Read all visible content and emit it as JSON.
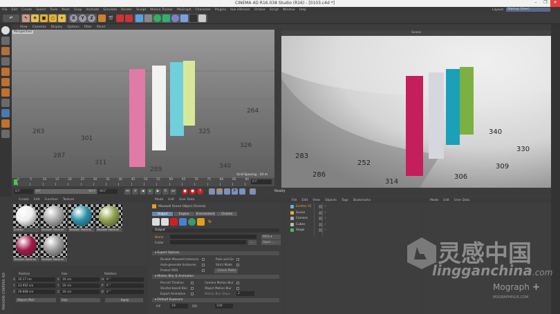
{
  "window": {
    "title": "CINEMA 4D R16.038 Studio (R16) - [0103.c4d *]",
    "minimize": "–",
    "maximize": "❐",
    "close": "✕"
  },
  "menu": [
    "File",
    "Edit",
    "Create",
    "Select",
    "Tools",
    "Mesh",
    "Snap",
    "Animate",
    "Simulate",
    "Render",
    "Sculpt",
    "Motion Tracker",
    "MoGraph",
    "Character",
    "Plugins",
    "Vue xStream",
    "Octane",
    "Script",
    "Window",
    "Help"
  ],
  "layout": {
    "label": "Layout:",
    "value": "Startup (User)"
  },
  "toolbar": {
    "axis_x": "X",
    "axis_y": "Y",
    "axis_z": "Z"
  },
  "viewport_left": {
    "menu": [
      "View",
      "Cameras",
      "Display",
      "Options",
      "Filter",
      "Panel"
    ],
    "name": "Perspective",
    "grid_spacing": "Grid Spacing : 10 m",
    "floor_numbers": [
      "311",
      "287",
      "340",
      "326",
      "289",
      "263",
      "325",
      "301",
      "264"
    ]
  },
  "viewport_right": {
    "name": "Scene",
    "floor_numbers": [
      "286",
      "314",
      "309",
      "330",
      "283",
      "306",
      "340",
      "252"
    ]
  },
  "timeline": {
    "ticks": [
      "0",
      "5",
      "10",
      "15",
      "20",
      "25",
      "30",
      "35",
      "40",
      "45",
      "50",
      "55",
      "60",
      "65",
      "70",
      "75",
      "80",
      "85",
      "90"
    ],
    "current_frame": "0 F",
    "start": "0 F",
    "range_start": "0 F",
    "range_end": "90 F",
    "end": "90 F"
  },
  "status": "Ready",
  "materials": {
    "menu": [
      "Create",
      "Edit",
      "Function",
      "Texture"
    ],
    "items": [
      {
        "label": "Emitter",
        "color": "#eeeeee"
      },
      {
        "label": "Maxwell Material",
        "color": "#a8a8a8"
      },
      {
        "label": "Maxwell Material",
        "color": "#2a8faa"
      },
      {
        "label": "Maxwell Material",
        "color": "#8ea048"
      },
      {
        "label": "Maxwell Material",
        "color": "#a3184a"
      },
      {
        "label": "Maxwell Material",
        "color": "#9a9a9a"
      }
    ]
  },
  "coordinates": {
    "position_label": "Position",
    "size_label": "Size",
    "rotation_label": "Rotation",
    "rows": [
      {
        "axis": "X",
        "pos": "35.17 cm",
        "size_axis": "X",
        "size": "10 cm",
        "rot_axis": "H",
        "rot": "0 °"
      },
      {
        "axis": "Y",
        "pos": "23.952 cm",
        "size_axis": "Y",
        "size": "10 cm",
        "rot_axis": "P",
        "rot": "0 °"
      },
      {
        "axis": "Z",
        "pos": "29.668 cm",
        "size_axis": "Z",
        "size": "10 cm",
        "rot_axis": "B",
        "rot": "0 °"
      }
    ],
    "mode": "Object (Rel)",
    "size_mode": "Size",
    "apply": "Apply"
  },
  "brand_vertical": "MAXON CINEMA 4D",
  "attributes": {
    "menu": [
      "Mode",
      "Edit",
      "User Data"
    ],
    "object": "Maxwell Scene Object [Scene]",
    "tabs": [
      "Output",
      "Engine",
      "Environment",
      "Cinema"
    ],
    "active_tab": "Output",
    "section_output": "Output",
    "name_label": "Name",
    "folder_label": "Folder",
    "format": "MXS ▾",
    "open": "Open ...",
    "browse": "...",
    "export_options": "Export Options",
    "export_left": [
      "Disable Maxwell Instances",
      "Auto-generate Instances",
      "Protect MXS"
    ],
    "export_right": [
      "Pack and Go",
      "Strict Mode"
    ],
    "check_paths": "Check Paths",
    "motion_blur": "Motion Blur & Animation",
    "mb_left": [
      "Pre-roll Timeline",
      "Shutter-based Blur",
      "Export Animation"
    ],
    "mb_right": [
      "Camera Motion Blur",
      "Object Motion Blur",
      "Motion Blur Steps"
    ],
    "mb_steps": "2",
    "default_exposure": "Default Exposure",
    "fstop_label": "f/#",
    "fstop": "18",
    "iso_label": "ISO",
    "iso": "100"
  },
  "objects": {
    "menu": [
      "File",
      "Edit",
      "View",
      "Objects",
      "Tags",
      "Bookmarks"
    ],
    "items": [
      {
        "name": "Emitter 01",
        "color": "#6ab0e0",
        "selected": true
      },
      {
        "name": "Scene",
        "color": "#e0b030"
      },
      {
        "name": "Camera",
        "color": "#aaaaaa"
      },
      {
        "name": "Cubes",
        "color": "#bbbbbb"
      },
      {
        "name": "Stage",
        "color": "#40c060"
      }
    ]
  },
  "attributes2": {
    "menu": [
      "Mode",
      "Edit",
      "User Data"
    ]
  },
  "watermark": {
    "chinese": "灵感中国",
    "site": "lingganchina",
    "tld": ".com",
    "mograph": "Mograph",
    "mograph_url": "MOGRAPHPLUS.COM"
  },
  "colors": {
    "accent": "#6d87b3",
    "pink": "#e07aa8",
    "cyan": "#6fd0dc",
    "yellow_green": "#d8e89a",
    "render_pink": "#c41e5c",
    "render_cyan": "#1aa0b8",
    "render_green": "#7cb040"
  }
}
